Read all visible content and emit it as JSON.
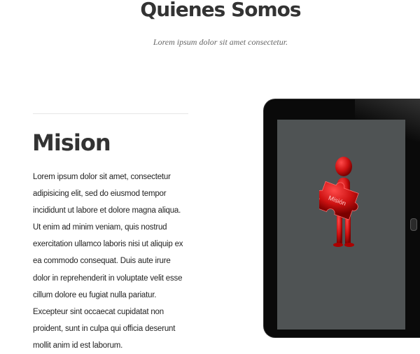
{
  "header": {
    "title": "Quienes Somos",
    "subtitle": "Lorem ipsum dolor sit amet consectetur."
  },
  "section": {
    "heading": "Mision",
    "body": "Lorem ipsum dolor sit amet, consectetur adipisicing elit, sed do eiusmod tempor incididunt ut labore et dolore magna aliqua. Ut enim ad minim veniam, quis nostrud exercitation ullamco laboris nisi ut aliquip ex ea commodo consequat. Duis aute irure dolor in reprehenderit in voluptate velit esse cillum dolore eu fugiat nulla pariatur. Excepteur sint occaecat cupidatat non proident, sunt in culpa qui officia deserunt mollit anim id est laborum."
  },
  "image": {
    "puzzle_label": "Misión",
    "figure_color": "#cc1111",
    "screen_color": "#4f5354"
  }
}
